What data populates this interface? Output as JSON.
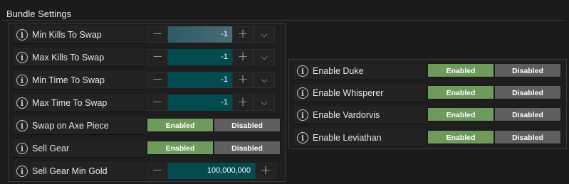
{
  "section_title": "Bundle Settings",
  "left_rows": [
    {
      "label": "Min Kills To Swap",
      "type": "stepper",
      "value": "-1",
      "minus": "−",
      "plus": "+",
      "chevron": "⌵"
    },
    {
      "label": "Max Kills To Swap",
      "type": "stepper",
      "value": "-1",
      "minus": "−",
      "plus": "+",
      "chevron": "⌵"
    },
    {
      "label": "Min Time To Swap",
      "type": "stepper",
      "value": "-1",
      "minus": "−",
      "plus": "+",
      "chevron": "⌵"
    },
    {
      "label": "Max Time To Swap",
      "type": "stepper",
      "value": "-1",
      "minus": "−",
      "plus": "+",
      "chevron": "⌵"
    },
    {
      "label": "Swap on Axe Piece",
      "type": "toggle",
      "on": "Enabled",
      "off": "Disabled"
    },
    {
      "label": "Sell Gear",
      "type": "toggle",
      "on": "Enabled",
      "off": "Disabled"
    },
    {
      "label": "Sell Gear Min Gold",
      "type": "stepper_wide",
      "value": "100,000,000",
      "minus": "−",
      "plus": "+"
    }
  ],
  "right_rows": [
    {
      "label": "Enable Duke",
      "on": "Enabled",
      "off": "Disabled"
    },
    {
      "label": "Enable Whisperer",
      "on": "Enabled",
      "off": "Disabled"
    },
    {
      "label": "Enable Vardorvis",
      "on": "Enabled",
      "off": "Disabled"
    },
    {
      "label": "Enable Leviathan",
      "on": "Enabled",
      "off": "Disabled"
    }
  ],
  "info_glyph": "i",
  "colors": {
    "enabled": "#6e9a5c",
    "disabled": "#5f5f5f",
    "number_field": "#024b4e"
  }
}
